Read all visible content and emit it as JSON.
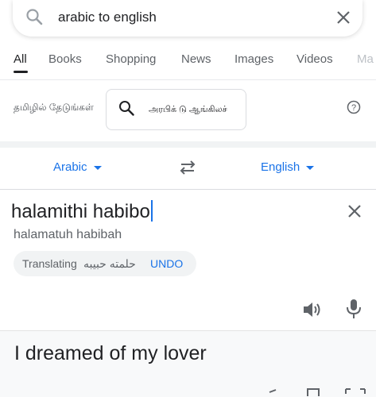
{
  "search": {
    "query": "arabic to english"
  },
  "tabs": [
    "All",
    "Books",
    "Shopping",
    "News",
    "Images",
    "Videos",
    "Ma"
  ],
  "tamil_row": {
    "label": "தமிழில் தேடுங்கள்",
    "chip_text": "அரபிக் டு ஆங்கிலச்"
  },
  "translator": {
    "source_lang": "Arabic",
    "target_lang": "English",
    "source_text": "halamithi habibo",
    "transliteration": "halamatuh habibah",
    "suggestion": {
      "prefix": "Translating",
      "arabic": "حلمته حبيبه",
      "undo": "UNDO"
    },
    "result_text": "I dreamed of my lover"
  },
  "colors": {
    "accent": "#1a73e8",
    "text": "#202124",
    "muted": "#5f6368"
  }
}
